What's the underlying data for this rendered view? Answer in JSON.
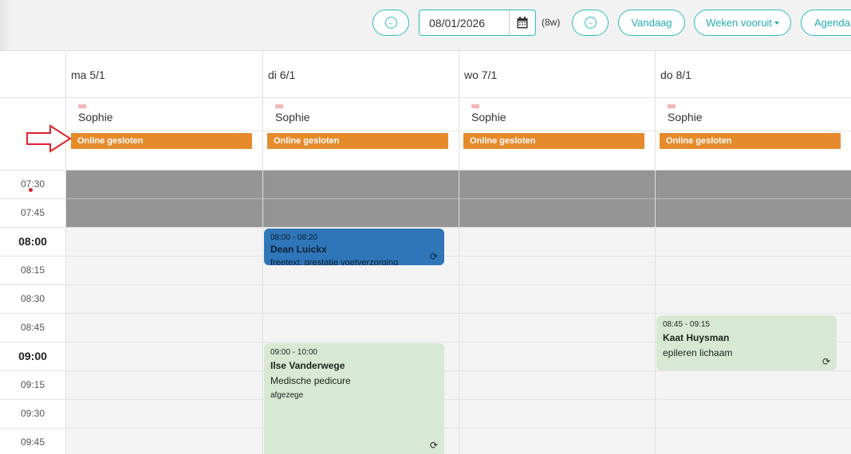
{
  "toolbar": {
    "prev_icon": "arrow-left-circle-icon",
    "date_value": "08/01/2026",
    "calendar_icon": "calendar-icon",
    "weeks_label": "(8w)",
    "next_icon": "arrow-right-circle-icon",
    "today_label": "Vandaag",
    "weeks_ahead_label": "Weken vooruit",
    "agenda_label": "Agenda",
    "accent_color": "#2bbcc0"
  },
  "days": [
    {
      "label": "ma 5/1",
      "staff": "Sophie",
      "status": "Online gesloten"
    },
    {
      "label": "di 6/1",
      "staff": "Sophie",
      "status": "Online gesloten"
    },
    {
      "label": "wo 7/1",
      "staff": "Sophie",
      "status": "Online gesloten"
    },
    {
      "label": "do 8/1",
      "staff": "Sophie",
      "status": "Online gesloten"
    }
  ],
  "times": [
    "07:30",
    "07:45",
    "08:00",
    "08:15",
    "08:30",
    "08:45",
    "09:00",
    "09:15",
    "09:30",
    "09:45"
  ],
  "appointments": [
    {
      "time": "08:00 - 08:20",
      "name": "Dean Luickx",
      "service": "freetext: prestatie voetverzorging",
      "color": "#2f76b8"
    },
    {
      "time": "09:00 - 10:00",
      "name": "Ilse Vanderwege",
      "service": "Medische pedicure",
      "note": "afgezege",
      "color": "#d8e9d3"
    },
    {
      "time": "08:45 - 09:15",
      "name": "Kaat Huysman",
      "service": "epileren lichaam",
      "color": "#d8e9d3"
    }
  ],
  "colors": {
    "closed": "#e58b2c",
    "unavailable": "#959595"
  }
}
